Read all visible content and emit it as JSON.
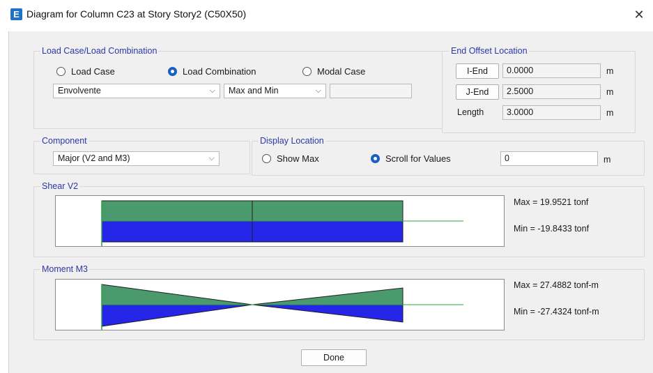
{
  "window": {
    "icon_letter": "E",
    "title": "Diagram for Column C23 at Story Story2 (C50X50)",
    "close_glyph": "✕"
  },
  "load_case_group": {
    "legend": "Load Case/Load Combination",
    "radios": [
      {
        "label": "Load Case",
        "selected": false
      },
      {
        "label": "Load Combination",
        "selected": true
      },
      {
        "label": "Modal Case",
        "selected": false
      }
    ],
    "combination_select": "Envolvente",
    "mode_select": "Max and Min",
    "extra_field": ""
  },
  "end_offset_group": {
    "legend": "End Offset Location",
    "i_end_label": "I-End",
    "i_end_value": "0.0000",
    "j_end_label": "J-End",
    "j_end_value": "2.5000",
    "length_label": "Length",
    "length_value": "3.0000",
    "unit": "m"
  },
  "component_group": {
    "legend": "Component",
    "selected": "Major (V2 and M3)"
  },
  "display_location_group": {
    "legend": "Display Location",
    "show_max_label": "Show Max",
    "show_max_selected": false,
    "scroll_label": "Scroll for Values",
    "scroll_selected": true,
    "location_value": "0",
    "unit": "m"
  },
  "shear_group": {
    "legend": "Shear V2",
    "max_text": "Max = 19.9521 tonf",
    "min_text": "Min = -19.8433 tonf",
    "max_value": 19.9521,
    "min_value": -19.8433
  },
  "moment_group": {
    "legend": "Moment M3",
    "max_text": "Max = 27.4882 tonf-m",
    "min_text": "Min = -27.4324 tonf-m",
    "max_value": 27.4882,
    "min_value": -27.4324
  },
  "footer": {
    "done_label": "Done"
  },
  "colors": {
    "positive_fill": "#4a9a6e",
    "negative_fill": "#2626e8",
    "baseline": "#2ea043",
    "legend_text": "#2a37a8",
    "radio_selected": "#1a5fc1"
  }
}
